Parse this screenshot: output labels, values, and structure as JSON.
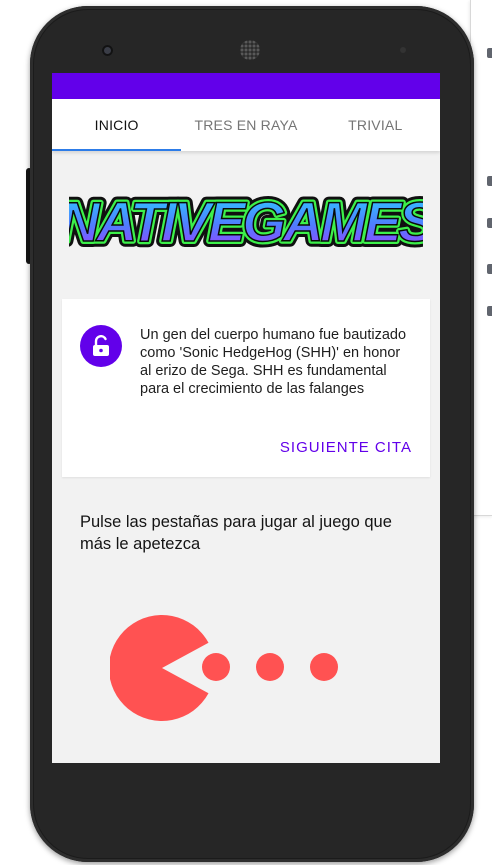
{
  "tabs": [
    {
      "label": "INICIO",
      "active": true
    },
    {
      "label": "TRES EN RAYA",
      "active": false
    },
    {
      "label": "TRIVIAL",
      "active": false
    }
  ],
  "logo": {
    "text": "NATIVEGAMES"
  },
  "quote_card": {
    "icon": "unlock-icon",
    "text": "Un gen del cuerpo humano fue bautizado como 'Sonic HedgeHog (SHH)' en honor al erizo de Sega. SHH es fundamental para el crecimiento de las falanges",
    "action_label": "SIGUIENTE CITA"
  },
  "hint": "Pulse las pestañas para jugar al juego que más le apetezca",
  "colors": {
    "primary": "#6200ea",
    "tab_indicator": "#2d7ce8",
    "pacman": "#ff5252"
  }
}
